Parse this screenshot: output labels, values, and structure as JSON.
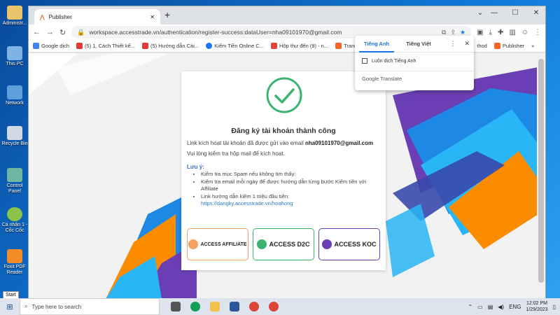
{
  "desktop": {
    "icons": [
      "Administr...",
      "This PC",
      "Network",
      "Recycle Bin",
      "Control Panel",
      "Cá nhân 1 - Cốc Cốc",
      "Foxit PDF Reader"
    ],
    "start_label": "Start"
  },
  "browser": {
    "tab_title": "Publisher",
    "url": "workspace.accesstrade.vn/authentication/register-success:dataUser=nha09101970@gmail.com",
    "bookmarks": [
      "Google dịch",
      "(5) 1. Cách Thiết kế...",
      "(5) Hướng dẫn Cài...",
      "Kiếm Tiền Online C...",
      "Hộp thư đến (9) - n...",
      "Trang tor",
      "thod",
      "Publisher"
    ]
  },
  "card": {
    "title": "Đăng ký tài khoản thành công",
    "line1": "Link kích hoạt tài khoản đã được gửi vào email ",
    "email": "nha09101970@gmail.com",
    "line2": "Vui lòng kiểm tra hộp mail để kích hoạt.",
    "note_label": "Lưu ý:",
    "bullets": [
      "Kiểm tra mục Spam nếu không tìm thấy:",
      "Kiểm tra email mỗi ngày để được hướng dẫn từng bước Kiếm tiền với Affiliate",
      "Link hướng dẫn kiếm 1 triệu đầu tiên:"
    ],
    "guide_link": "https://dangky.accesstrade.vn/hoahong",
    "badges": [
      "ACCESS AFFILIATE",
      "ACCESS D2C",
      "ACCESS KOC"
    ]
  },
  "translate": {
    "tab_en": "Tiếng Anh",
    "tab_vi": "Tiếng Việt",
    "option": "Luôn dịch Tiếng Anh",
    "footer": "Google Translate"
  },
  "taskbar": {
    "search_placeholder": "Type here to search",
    "lang": "ENG",
    "time": "12:02 PM",
    "date": "1/29/2023"
  },
  "colors": {
    "success": "#3cb371",
    "accent": "#1a73e8",
    "brand": "#f26522"
  }
}
